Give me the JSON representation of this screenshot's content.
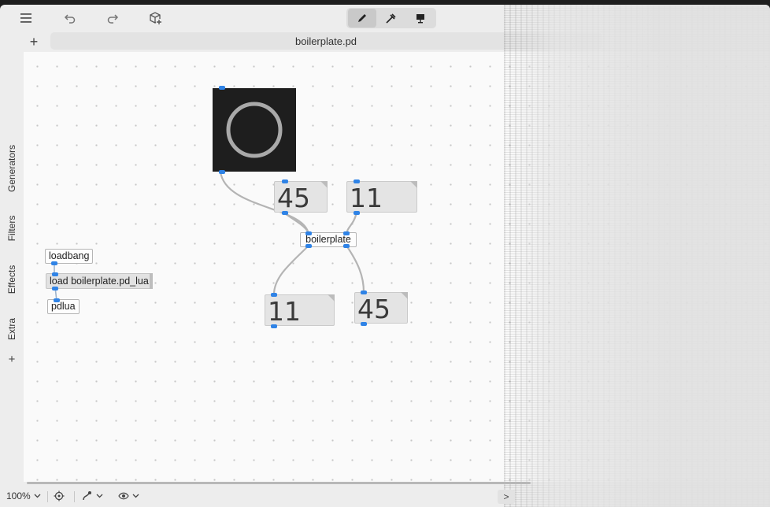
{
  "toolbar": {
    "icons": [
      "menu-icon",
      "undo-icon",
      "redo-icon",
      "add-object-icon"
    ],
    "modes": [
      {
        "name": "edit-mode",
        "icon": "pencil-icon",
        "active": true
      },
      {
        "name": "run-mode",
        "icon": "hand-icon",
        "active": false
      },
      {
        "name": "presentation-mode",
        "icon": "presentation-icon",
        "active": false
      }
    ]
  },
  "tabbar": {
    "add_label": "+",
    "active_tab": "boilerplate.pd"
  },
  "sidebar": {
    "items": [
      "Generators",
      "Filters",
      "Effects",
      "Extra"
    ],
    "add_label": "+"
  },
  "canvas": {
    "objects": {
      "loadbang": "loadbang",
      "load_message": "load boilerplate.pd_lua",
      "pdlua": "pdlua",
      "boilerplate": "boilerplate"
    },
    "number_boxes": {
      "input_left": "45",
      "input_right": "11",
      "output_left": "11",
      "output_right": "45"
    },
    "colors": {
      "port": "#2f83e6",
      "scope_bg": "#1e1e1e",
      "scope_ring": "#a9a9a9"
    }
  },
  "bottombar": {
    "zoom": "100%",
    "icons": [
      "zoom-dropdown-icon",
      "target-icon",
      "connection-style-icon",
      "visibility-icon"
    ],
    "console_label": ">"
  }
}
